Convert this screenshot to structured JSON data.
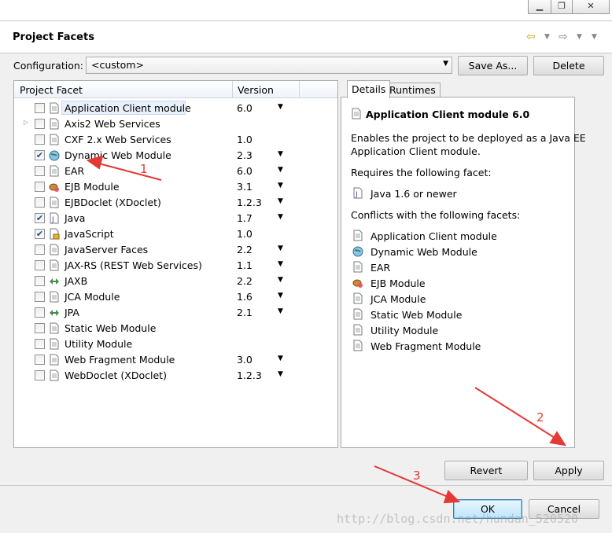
{
  "header": {
    "title": "Project Facets"
  },
  "config": {
    "label": "Configuration:",
    "value": "<custom>",
    "save_as": "Save As...",
    "delete": "Delete"
  },
  "table": {
    "col_facet": "Project Facet",
    "col_version": "Version"
  },
  "facets": [
    {
      "name": "Application Client module",
      "version": "6.0",
      "checked": false,
      "dropdown": true,
      "icon": "document-icon"
    },
    {
      "name": "Axis2 Web Services",
      "version": "",
      "checked": false,
      "dropdown": false,
      "icon": "document-icon",
      "expandable": true
    },
    {
      "name": "CXF 2.x Web Services",
      "version": "1.0",
      "checked": false,
      "dropdown": false,
      "icon": "document-icon"
    },
    {
      "name": "Dynamic Web Module",
      "version": "2.3",
      "checked": true,
      "dropdown": true,
      "icon": "globe-icon"
    },
    {
      "name": "EAR",
      "version": "6.0",
      "checked": false,
      "dropdown": true,
      "icon": "document-icon"
    },
    {
      "name": "EJB Module",
      "version": "3.1",
      "checked": false,
      "dropdown": true,
      "icon": "bean-icon"
    },
    {
      "name": "EJBDoclet (XDoclet)",
      "version": "1.2.3",
      "checked": false,
      "dropdown": true,
      "icon": "document-icon"
    },
    {
      "name": "Java",
      "version": "1.7",
      "checked": true,
      "dropdown": true,
      "icon": "java-icon"
    },
    {
      "name": "JavaScript",
      "version": "1.0",
      "checked": true,
      "dropdown": false,
      "icon": "javascript-icon"
    },
    {
      "name": "JavaServer Faces",
      "version": "2.2",
      "checked": false,
      "dropdown": true,
      "icon": "document-icon"
    },
    {
      "name": "JAX-RS (REST Web Services)",
      "version": "1.1",
      "checked": false,
      "dropdown": true,
      "icon": "document-icon"
    },
    {
      "name": "JAXB",
      "version": "2.2",
      "checked": false,
      "dropdown": true,
      "icon": "arrows-icon"
    },
    {
      "name": "JCA Module",
      "version": "1.6",
      "checked": false,
      "dropdown": true,
      "icon": "document-icon"
    },
    {
      "name": "JPA",
      "version": "2.1",
      "checked": false,
      "dropdown": true,
      "icon": "arrows-icon"
    },
    {
      "name": "Static Web Module",
      "version": "",
      "checked": false,
      "dropdown": false,
      "icon": "document-icon"
    },
    {
      "name": "Utility Module",
      "version": "",
      "checked": false,
      "dropdown": false,
      "icon": "document-icon"
    },
    {
      "name": "Web Fragment Module",
      "version": "3.0",
      "checked": false,
      "dropdown": true,
      "icon": "document-icon"
    },
    {
      "name": "WebDoclet (XDoclet)",
      "version": "1.2.3",
      "checked": false,
      "dropdown": true,
      "icon": "document-icon"
    }
  ],
  "details": {
    "tab_details": "Details",
    "tab_runtimes": "Runtimes",
    "title": "Application Client module 6.0",
    "desc_line1": "Enables the project to be deployed as a Java EE",
    "desc_line2": "Application Client module.",
    "requires_label": "Requires the following facet:",
    "requires": [
      {
        "name": "Java 1.6 or newer",
        "icon": "java-icon"
      }
    ],
    "conflicts_label": "Conflicts with the following facets:",
    "conflicts": [
      {
        "name": "Application Client module",
        "icon": "document-icon"
      },
      {
        "name": "Dynamic Web Module",
        "icon": "globe-icon"
      },
      {
        "name": "EAR",
        "icon": "document-icon"
      },
      {
        "name": "EJB Module",
        "icon": "bean-icon"
      },
      {
        "name": "JCA Module",
        "icon": "document-icon"
      },
      {
        "name": "Static Web Module",
        "icon": "document-icon"
      },
      {
        "name": "Utility Module",
        "icon": "document-icon"
      },
      {
        "name": "Web Fragment Module",
        "icon": "document-icon"
      }
    ]
  },
  "buttons": {
    "revert": "Revert",
    "apply": "Apply",
    "ok": "OK",
    "cancel": "Cancel"
  },
  "annotations": {
    "a1": "1",
    "a2": "2",
    "a3": "3",
    "color": "#e53935"
  },
  "watermark": "http://blog.csdn.net/hundan_520520"
}
